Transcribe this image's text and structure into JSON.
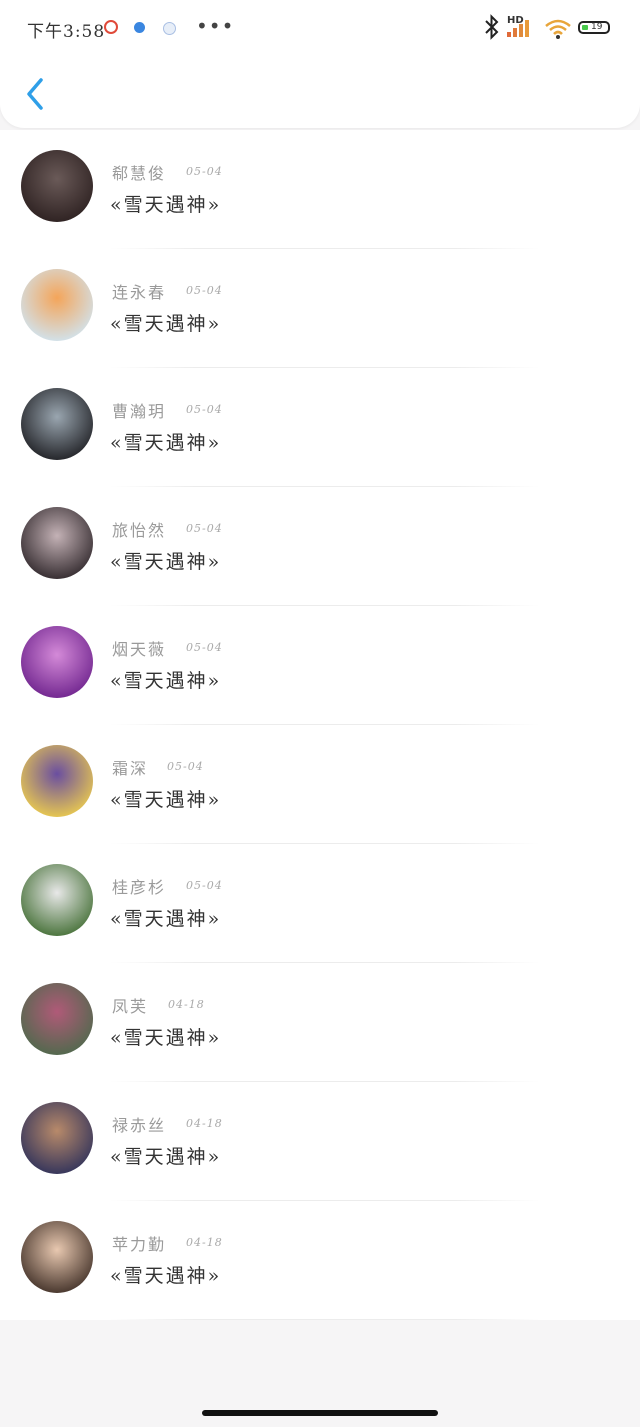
{
  "status_bar": {
    "time": "下午3:58",
    "more": "•••",
    "battery_level": "19"
  },
  "header": {
    "back_icon": "chevron-left-icon",
    "accent_color": "#2f9fe8"
  },
  "conversations": [
    {
      "name": "郗慧俊",
      "date": "05-04",
      "message": "«雪天遇神»",
      "avatar_colors": [
        "#2a1e1e",
        "#6a5a58"
      ]
    },
    {
      "name": "连永春",
      "date": "05-04",
      "message": "«雪天遇神»",
      "avatar_colors": [
        "#cfe7f7",
        "#f4a55a"
      ]
    },
    {
      "name": "曹瀚玥",
      "date": "05-04",
      "message": "«雪天遇神»",
      "avatar_colors": [
        "#1a1a1e",
        "#9aa6b0"
      ]
    },
    {
      "name": "旅怡然",
      "date": "05-04",
      "message": "«雪天遇神»",
      "avatar_colors": [
        "#2a2226",
        "#c4b2b6"
      ]
    },
    {
      "name": "烟天薇",
      "date": "05-04",
      "message": "«雪天遇神»",
      "avatar_colors": [
        "#6a1f8a",
        "#d48ad8"
      ]
    },
    {
      "name": "霜深",
      "date": "05-04",
      "message": "«雪天遇神»",
      "avatar_colors": [
        "#f2d24a",
        "#6a4ea0"
      ]
    },
    {
      "name": "桂彦杉",
      "date": "05-04",
      "message": "«雪天遇神»",
      "avatar_colors": [
        "#3d6a2e",
        "#e8e8e8"
      ]
    },
    {
      "name": "凤芙",
      "date": "04-18",
      "message": "«雪天遇神»",
      "avatar_colors": [
        "#4a6a4a",
        "#b05a78"
      ]
    },
    {
      "name": "禄赤丝",
      "date": "04-18",
      "message": "«雪天遇神»",
      "avatar_colors": [
        "#2a2e5a",
        "#b88a6a"
      ]
    },
    {
      "name": "苹力勤",
      "date": "04-18",
      "message": "«雪天遇神»",
      "avatar_colors": [
        "#3a2a22",
        "#e8c8b0"
      ]
    }
  ]
}
